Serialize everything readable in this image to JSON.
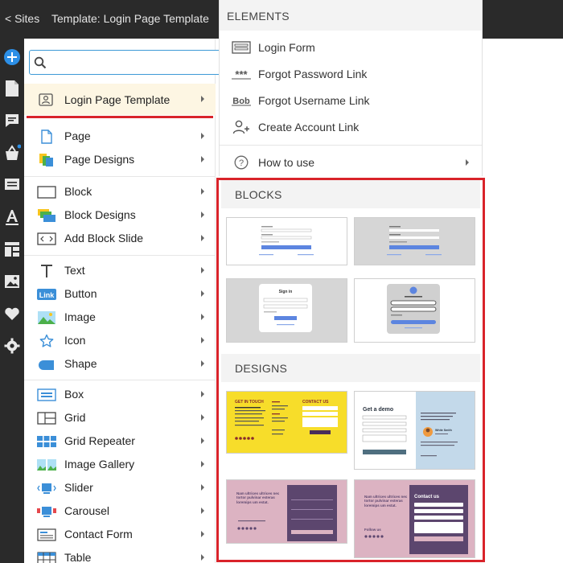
{
  "topbar": {
    "back_label": "< Sites",
    "template_label": "Template: Login Page Template"
  },
  "rail": {
    "icons": [
      "add-icon",
      "page-icon",
      "comment-icon",
      "shop-icon",
      "list-icon",
      "text-style-icon",
      "layout-icon",
      "image-icon",
      "heart-icon",
      "settings-icon"
    ]
  },
  "panel": {
    "search_placeholder": "",
    "template_item": "Login Page Template",
    "groups": [
      [
        {
          "label": "Page",
          "icon": "page-icon"
        },
        {
          "label": "Page Designs",
          "icon": "page-designs-icon"
        }
      ],
      [
        {
          "label": "Block",
          "icon": "block-icon"
        },
        {
          "label": "Block Designs",
          "icon": "block-designs-icon"
        },
        {
          "label": "Add Block Slide",
          "icon": "block-slide-icon"
        }
      ],
      [
        {
          "label": "Text",
          "icon": "text-icon"
        },
        {
          "label": "Button",
          "icon": "button-icon",
          "badge": "Link"
        },
        {
          "label": "Image",
          "icon": "image-icon"
        },
        {
          "label": "Icon",
          "icon": "star-icon"
        },
        {
          "label": "Shape",
          "icon": "shape-icon"
        }
      ],
      [
        {
          "label": "Box",
          "icon": "box-icon"
        },
        {
          "label": "Grid",
          "icon": "grid-icon"
        },
        {
          "label": "Grid Repeater",
          "icon": "grid-repeater-icon"
        },
        {
          "label": "Image Gallery",
          "icon": "gallery-icon"
        },
        {
          "label": "Slider",
          "icon": "slider-icon"
        },
        {
          "label": "Carousel",
          "icon": "carousel-icon"
        },
        {
          "label": "Contact Form",
          "icon": "contact-form-icon"
        },
        {
          "label": "Table",
          "icon": "table-icon"
        }
      ]
    ]
  },
  "elements": {
    "header": "ELEMENTS",
    "items": [
      {
        "label": "Login Form",
        "icon": "login-form-icon"
      },
      {
        "label": "Forgot Password Link",
        "icon": "password-dots-icon",
        "glyph": "***"
      },
      {
        "label": "Forgot Username Link",
        "icon": "username-text-icon",
        "glyph": "Bob"
      },
      {
        "label": "Create Account Link",
        "icon": "add-user-icon"
      }
    ],
    "how_to_use": "How to use"
  },
  "blocks": {
    "header": "BLOCKS",
    "thumb_title": "Sign in"
  },
  "designs": {
    "header": "DESIGNS",
    "cards": [
      {
        "title": "GET IN TOUCH",
        "contact": "CONTACT US"
      },
      {
        "title": "Get a demo",
        "person": "White Smith"
      },
      {
        "headline": "Nam ultrices ultrices nec tortor pulvinar esteras loremips um estat."
      },
      {
        "headline": "Nam ultrices ultrices nec tortor pulvinar esteras loremips um estat.",
        "contact": "Contact us",
        "follow": "Follow us"
      }
    ]
  },
  "colors": {
    "dark_bar": "#2a2a2a",
    "accent_blue": "#3d9ad6",
    "highlight_red": "#d9232a",
    "yellow": "#f7dd2a",
    "pink": "#dcb3c2",
    "purple": "#5c466e",
    "light_blue": "#c3d9ea"
  }
}
